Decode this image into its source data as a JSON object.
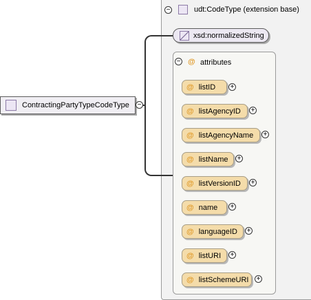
{
  "root_element": {
    "label": "ContractingPartyTypeCodeType"
  },
  "extension": {
    "label": "udt:CodeType (extension base)"
  },
  "base_type": {
    "label": "xsd:normalizedString"
  },
  "attributes_group": {
    "label": "attributes",
    "symbol": "@"
  },
  "attributes": [
    {
      "label": "listID",
      "symbol": "@"
    },
    {
      "label": "listAgencyID",
      "symbol": "@"
    },
    {
      "label": "listAgencyName",
      "symbol": "@"
    },
    {
      "label": "listName",
      "symbol": "@"
    },
    {
      "label": "listVersionID",
      "symbol": "@"
    },
    {
      "label": "name",
      "symbol": "@"
    },
    {
      "label": "languageID",
      "symbol": "@"
    },
    {
      "label": "listURI",
      "symbol": "@"
    },
    {
      "label": "listSchemeURI",
      "symbol": "@"
    }
  ],
  "colors": {
    "attribute_fill": "#f4dcaa",
    "attribute_symbol": "#e09a2a",
    "element_fill": "#f0eef3",
    "container_fill": "#f2f2f2"
  }
}
